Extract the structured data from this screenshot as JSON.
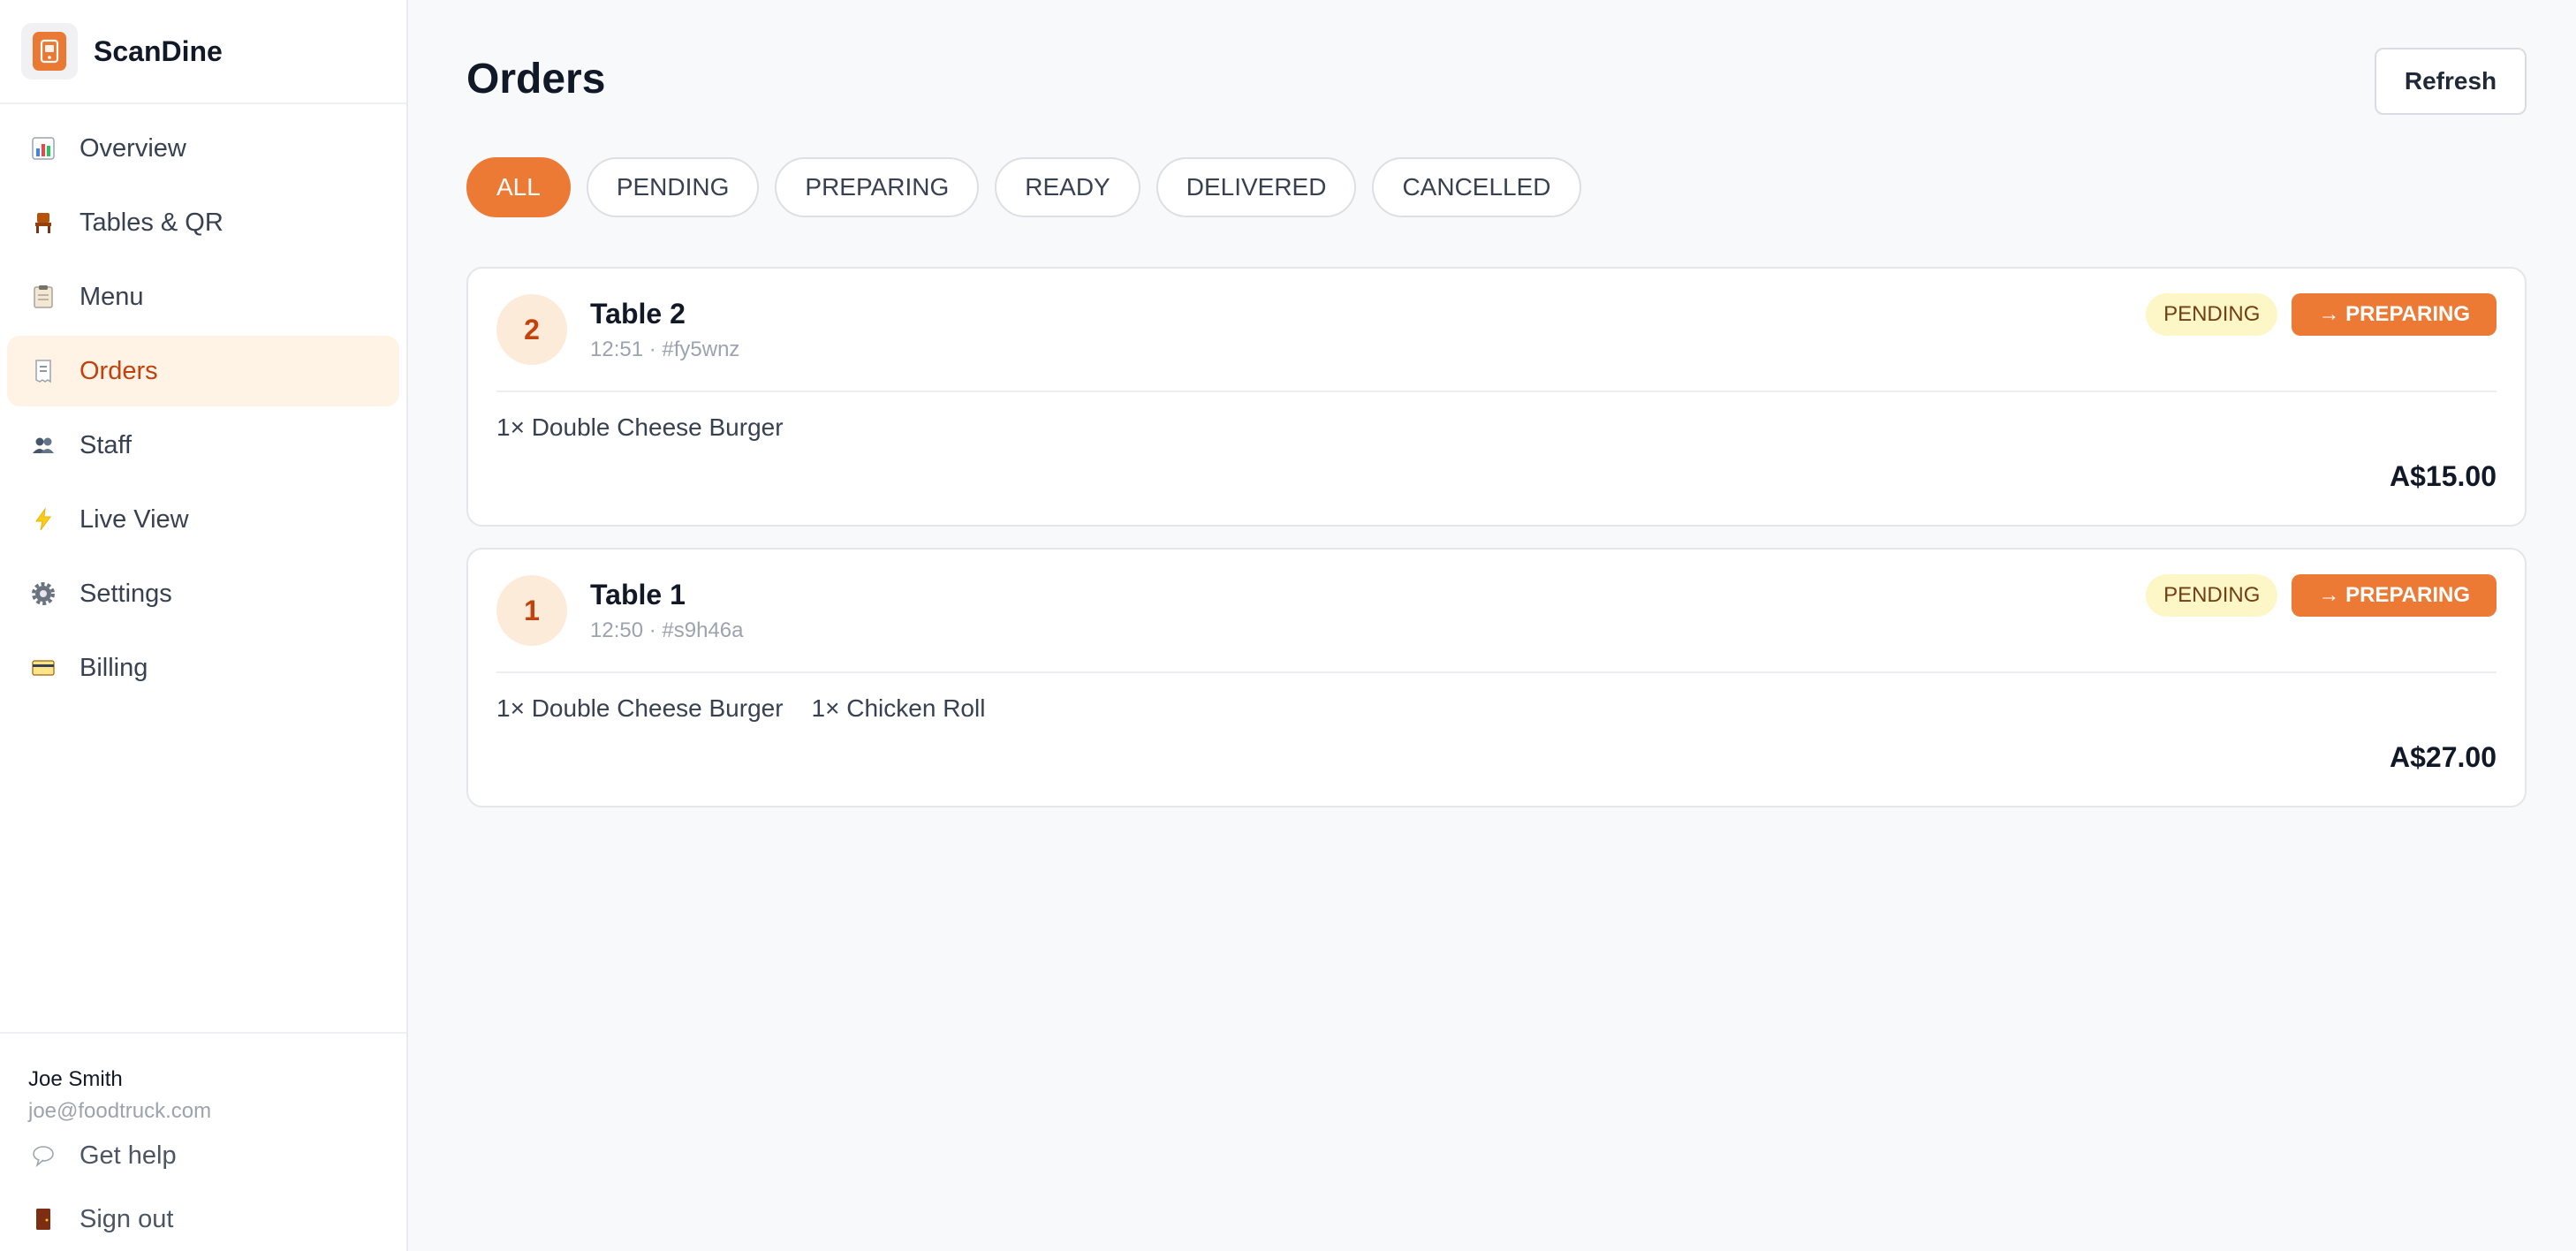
{
  "brand": {
    "name": "ScanDine"
  },
  "nav": [
    {
      "label": "Overview",
      "icon": "chart-icon",
      "active": false
    },
    {
      "label": "Tables & QR",
      "icon": "chair-icon",
      "active": false
    },
    {
      "label": "Menu",
      "icon": "clipboard-icon",
      "active": false
    },
    {
      "label": "Orders",
      "icon": "receipt-icon",
      "active": true
    },
    {
      "label": "Staff",
      "icon": "people-icon",
      "active": false
    },
    {
      "label": "Live View",
      "icon": "lightning-icon",
      "active": false
    },
    {
      "label": "Settings",
      "icon": "gear-icon",
      "active": false
    },
    {
      "label": "Billing",
      "icon": "credit-card-icon",
      "active": false
    }
  ],
  "user": {
    "name": "Joe Smith",
    "email": "joe@foodtruck.com"
  },
  "footer": {
    "help_label": "Get help",
    "signout_label": "Sign out"
  },
  "page": {
    "title": "Orders",
    "refresh_label": "Refresh"
  },
  "filters": [
    "ALL",
    "PENDING",
    "PREPARING",
    "READY",
    "DELIVERED",
    "CANCELLED"
  ],
  "active_filter": "ALL",
  "orders": [
    {
      "table_number": "2",
      "table_name": "Table 2",
      "meta": "12:51 · #fy5wnz",
      "status": "PENDING",
      "action_label": "→ PREPARING",
      "items": [
        "1× Double Cheese Burger"
      ],
      "total": "A$15.00"
    },
    {
      "table_number": "1",
      "table_name": "Table 1",
      "meta": "12:50 · #s9h46a",
      "status": "PENDING",
      "action_label": "→ PREPARING",
      "items": [
        "1× Double Cheese Burger",
        "1× Chicken Roll"
      ],
      "total": "A$27.00"
    }
  ],
  "colors": {
    "accent": "#ec7a35",
    "active_nav_bg": "#fff3e6",
    "active_nav_text": "#c2410c",
    "pending_badge_bg": "#fdf6c7"
  }
}
